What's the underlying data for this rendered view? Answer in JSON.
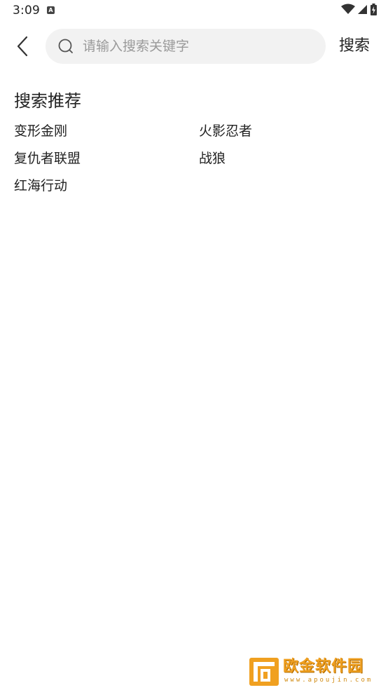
{
  "status_bar": {
    "time": "3:09",
    "notification_icon": "A"
  },
  "header": {
    "search_placeholder": "请输入搜索关键字",
    "search_value": "",
    "search_button_label": "搜索"
  },
  "recommendations": {
    "title": "搜索推荐",
    "items": [
      {
        "label": "变形金刚"
      },
      {
        "label": "火影忍者"
      },
      {
        "label": "复仇者联盟"
      },
      {
        "label": "战狼"
      },
      {
        "label": "红海行动"
      }
    ]
  },
  "watermark": {
    "brand": "欧金软件园",
    "url": "www.apoujin.com"
  },
  "colors": {
    "search_bg": "#f2f2f2",
    "placeholder": "#9a9a9a",
    "watermark_accent": "#f0a020"
  }
}
